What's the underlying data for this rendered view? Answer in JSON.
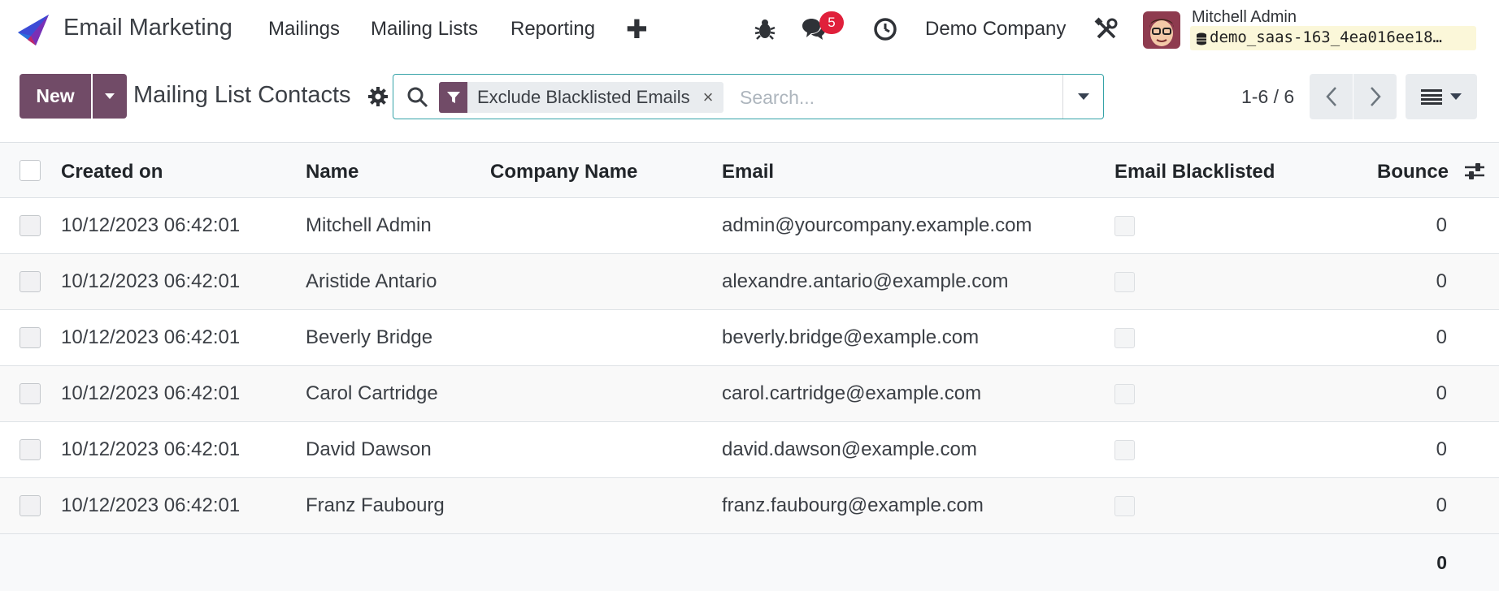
{
  "navbar": {
    "app_name": "Email Marketing",
    "menu": [
      "Mailings",
      "Mailing Lists",
      "Reporting"
    ],
    "messages_count": "5",
    "company": "Demo Company",
    "user_name": "Mitchell Admin",
    "database": "demo_saas-163_4ea016ee18…",
    "icons": [
      "plus-icon",
      "bug-icon",
      "chat-icon",
      "clock-icon",
      "tools-icon",
      "database-icon"
    ]
  },
  "control": {
    "new_label": "New",
    "title": "Mailing List Contacts",
    "facet_label": "Exclude Blacklisted Emails",
    "facet_close": "×",
    "search_placeholder": "Search...",
    "pager": "1-6 / 6"
  },
  "table": {
    "columns": [
      "Created on",
      "Name",
      "Company Name",
      "Email",
      "Email Blacklisted",
      "Bounce"
    ],
    "rows": [
      {
        "created": "10/12/2023 06:42:01",
        "name": "Mitchell Admin",
        "company": "",
        "email": "admin@yourcompany.example.com",
        "blacklisted": false,
        "bounce": "0"
      },
      {
        "created": "10/12/2023 06:42:01",
        "name": "Aristide Antario",
        "company": "",
        "email": "alexandre.antario@example.com",
        "blacklisted": false,
        "bounce": "0"
      },
      {
        "created": "10/12/2023 06:42:01",
        "name": "Beverly Bridge",
        "company": "",
        "email": "beverly.bridge@example.com",
        "blacklisted": false,
        "bounce": "0"
      },
      {
        "created": "10/12/2023 06:42:01",
        "name": "Carol Cartridge",
        "company": "",
        "email": "carol.cartridge@example.com",
        "blacklisted": false,
        "bounce": "0"
      },
      {
        "created": "10/12/2023 06:42:01",
        "name": "David Dawson",
        "company": "",
        "email": "david.dawson@example.com",
        "blacklisted": false,
        "bounce": "0"
      },
      {
        "created": "10/12/2023 06:42:01",
        "name": "Franz Faubourg",
        "company": "",
        "email": "franz.faubourg@example.com",
        "blacklisted": false,
        "bounce": "0"
      }
    ],
    "footer_bounce_total": "0"
  },
  "colors": {
    "brand": "#714b67",
    "accent_border": "#36a3a8",
    "badge": "#e0203b"
  }
}
